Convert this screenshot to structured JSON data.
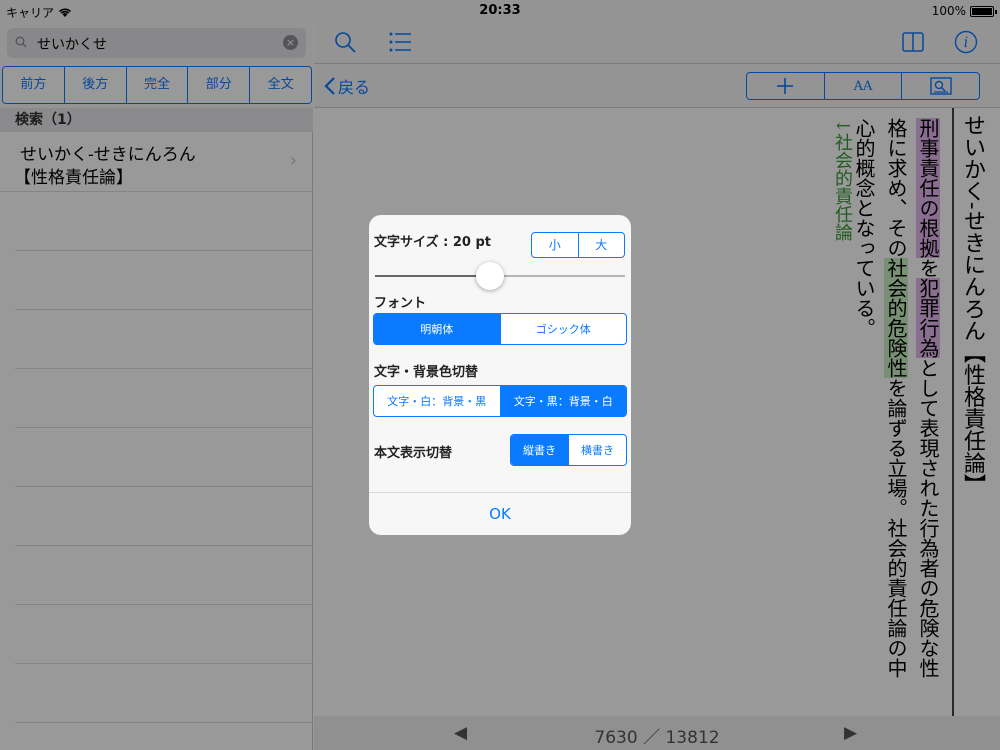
{
  "status": {
    "carrier": "キャリア",
    "time": "20:33",
    "battery": "100%"
  },
  "search": {
    "query": "せいかくせ",
    "clear_glyph": "×"
  },
  "search_modes": [
    {
      "label": "前方",
      "active": true
    },
    {
      "label": "後方",
      "active": false
    },
    {
      "label": "完全",
      "active": false
    },
    {
      "label": "部分",
      "active": false
    },
    {
      "label": "全文",
      "active": false
    }
  ],
  "results": {
    "header": "検索（1）",
    "items": [
      {
        "reading": "せいかく-せきにんろん",
        "title": "【性格責任論】"
      }
    ]
  },
  "nav": {
    "back_label": "戻る",
    "font_tool_label": "AA"
  },
  "article": {
    "headword": "せいかく-せきにんろん【性格責任論】",
    "body_parts": [
      {
        "text": "刑事責任の根拠",
        "hl": "purple"
      },
      {
        "text": "を",
        "hl": ""
      },
      {
        "text": "犯罪行為",
        "hl": "purple"
      },
      {
        "text": "として表現された行為者の危険な性格に求め、その",
        "hl": ""
      },
      {
        "text": "社会的危険性",
        "hl": "green"
      },
      {
        "text": "を論ずる立場。社会的責任論の中心的概念となっている。",
        "hl": ""
      }
    ],
    "reference": "↓社会的責任論"
  },
  "pager": {
    "label": "7630 ／ 13812",
    "prev": "◀",
    "next": "▶"
  },
  "dialog": {
    "font_size_label": "文字サイズ : 20 pt",
    "size_small": "小",
    "size_large": "大",
    "slider_value": 0.46,
    "font_label": "フォント",
    "font_options": [
      {
        "label": "明朝体",
        "active": true
      },
      {
        "label": "ゴシック体",
        "active": false
      }
    ],
    "color_label": "文字・背景色切替",
    "color_options": [
      {
        "label": "文字・白：背景・黒",
        "active": false
      },
      {
        "label": "文字・黒：背景・白",
        "active": true
      }
    ],
    "direction_label": "本文表示切替",
    "direction_options": [
      {
        "label": "縦書き",
        "active": true
      },
      {
        "label": "横書き",
        "active": false
      }
    ],
    "ok_label": "OK"
  },
  "colors": {
    "accent": "#0a7aff",
    "highlight_purple": "#e5b8f0",
    "highlight_green": "#c8f0c0",
    "reference_green": "#3a9a3a"
  }
}
